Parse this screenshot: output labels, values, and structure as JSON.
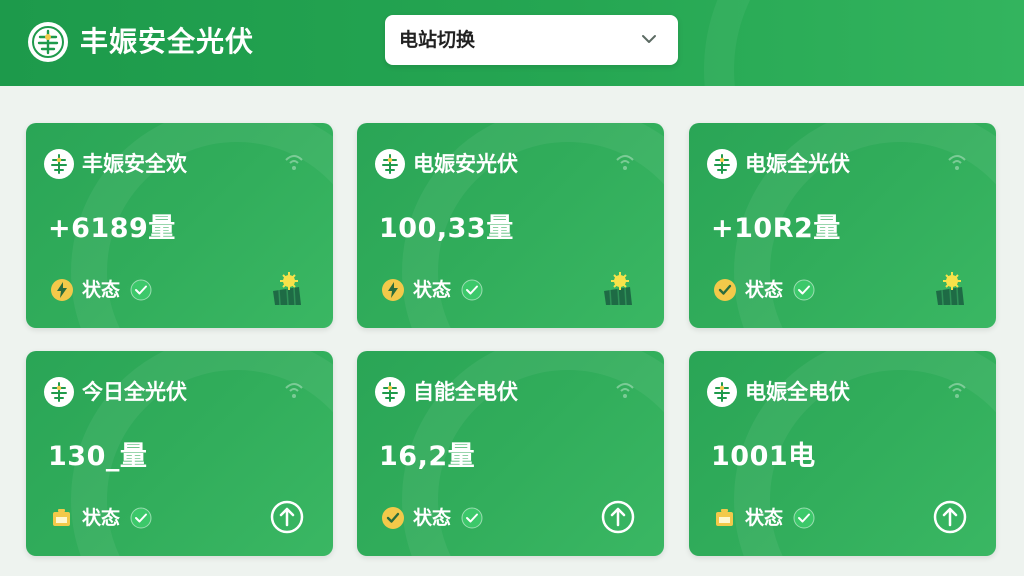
{
  "header": {
    "app_title": "丰娠安全光伏",
    "station_selector": {
      "value": "电站切换"
    }
  },
  "cards": [
    {
      "title": "丰娠安全欢",
      "value": "+6189量",
      "status": "状态",
      "status_icon": "bolt-badge-icon",
      "right_icon": "solar-panel-icon"
    },
    {
      "title": "电娠安光伏",
      "value": "100,33量",
      "status": "状态",
      "status_icon": "bolt-badge-icon",
      "right_icon": "solar-panel-icon"
    },
    {
      "title": "电娠全光伏",
      "value": "+10R2量",
      "status": "状态",
      "status_icon": "check-badge-icon",
      "right_icon": "solar-panel-icon"
    },
    {
      "title": "今日全光伏",
      "value": "130_量",
      "status": "状态",
      "status_icon": "battery-icon",
      "right_icon": "upload-circle-icon"
    },
    {
      "title": "自能全电伏",
      "value": "16,2量",
      "status": "状态",
      "status_icon": "check-badge-icon",
      "right_icon": "upload-circle-icon"
    },
    {
      "title": "电娠全电伏",
      "value": "1001电",
      "status": "状态",
      "status_icon": "battery-icon",
      "right_icon": "upload-circle-icon"
    }
  ],
  "colors": {
    "brand_green": "#25a652",
    "card_green": "#31ad5b",
    "badge_yellow": "#f3c94a",
    "check_green": "#3cc86a"
  }
}
